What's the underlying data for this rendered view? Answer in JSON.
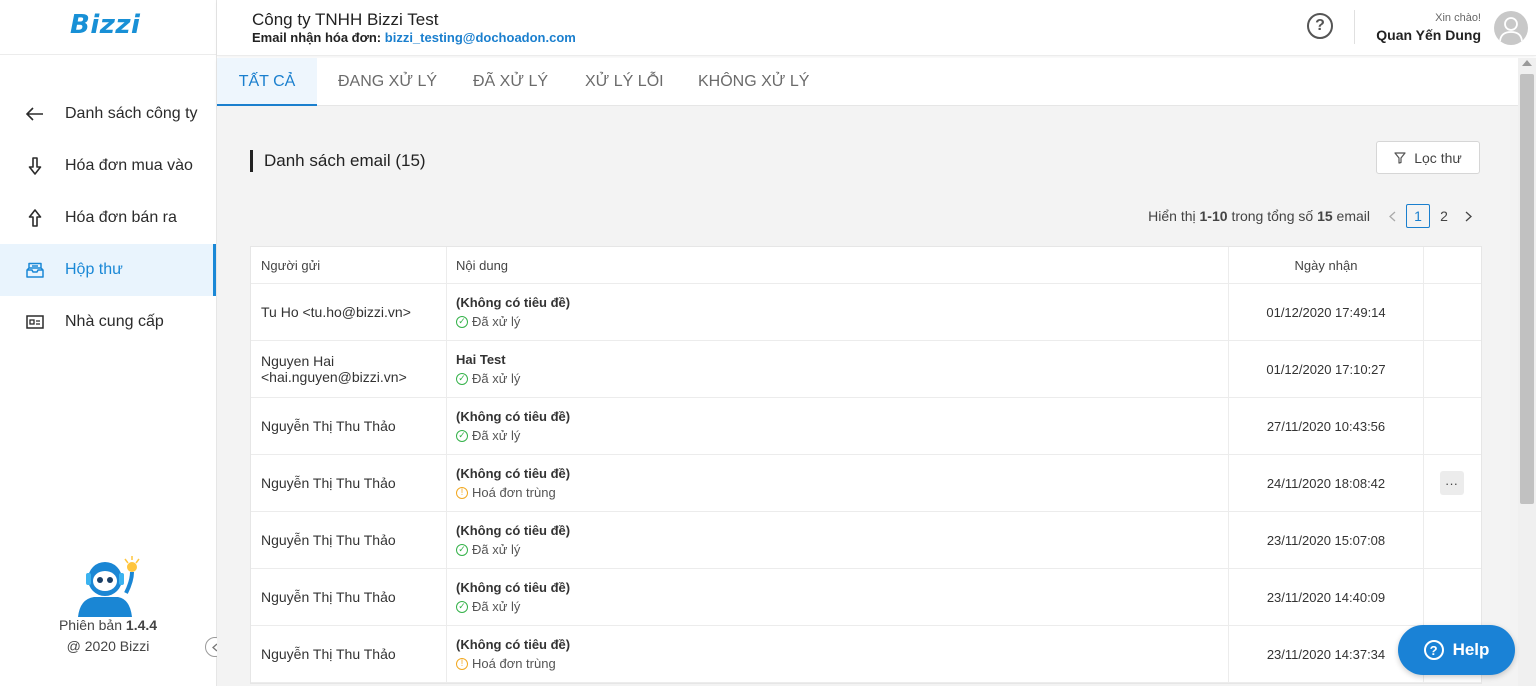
{
  "brand": {
    "logo": "Bizzi"
  },
  "header": {
    "company": "Công ty TNHH Bizzi Test",
    "email_label": "Email nhận hóa đơn:",
    "email": "bizzi_testing@dochoadon.com",
    "help_glyph": "?",
    "greeting": "Xin chào!",
    "user_name": "Quan Yến Dung"
  },
  "sidebar": {
    "items": [
      {
        "label": "Danh sách công ty",
        "icon": "arrow-left-icon"
      },
      {
        "label": "Hóa đơn mua vào",
        "icon": "arrow-down-icon"
      },
      {
        "label": "Hóa đơn bán ra",
        "icon": "arrow-up-icon"
      },
      {
        "label": "Hộp thư",
        "icon": "inbox-icon",
        "active": true
      },
      {
        "label": "Nhà cung cấp",
        "icon": "id-card-icon"
      }
    ],
    "version_label": "Phiên bản",
    "version": "1.4.4",
    "copyright": "@ 2020 Bizzi"
  },
  "tabs": [
    {
      "label": "TẤT CẢ",
      "active": true
    },
    {
      "label": "ĐANG XỬ LÝ"
    },
    {
      "label": "ĐÃ XỬ LÝ"
    },
    {
      "label": "XỬ LÝ LỖI"
    },
    {
      "label": "KHÔNG XỬ LÝ"
    }
  ],
  "main": {
    "section_title": "Danh sách email (15)",
    "filter_label": "Lọc thư",
    "pager": {
      "prefix": "Hiển thị",
      "range": "1-10",
      "middle": "trong tổng số",
      "total": "15",
      "suffix": "email",
      "pages": [
        "1",
        "2"
      ],
      "current": "1"
    },
    "table": {
      "headers": [
        "Người gửi",
        "Nội dung",
        "Ngày nhận"
      ],
      "rows": [
        {
          "sender": "Tu Ho <tu.ho@bizzi.vn>",
          "subject": "(Không có tiêu đề)",
          "status": "Đã xử lý",
          "status_type": "ok",
          "date": "01/12/2020 17:49:14"
        },
        {
          "sender": "Nguyen Hai <hai.nguyen@bizzi.vn>",
          "subject": "Hai Test",
          "status": "Đã xử lý",
          "status_type": "ok",
          "date": "01/12/2020 17:10:27"
        },
        {
          "sender": "Nguyễn Thị Thu Thảo",
          "subject": "(Không có tiêu đề)",
          "status": "Đã xử lý",
          "status_type": "ok",
          "date": "27/11/2020 10:43:56"
        },
        {
          "sender": "Nguyễn Thị Thu Thảo",
          "subject": "(Không có tiêu đề)",
          "status": "Hoá đơn trùng",
          "status_type": "warn",
          "date": "24/11/2020 18:08:42",
          "more": "···"
        },
        {
          "sender": "Nguyễn Thị Thu Thảo",
          "subject": "(Không có tiêu đề)",
          "status": "Đã xử lý",
          "status_type": "ok",
          "date": "23/11/2020 15:07:08"
        },
        {
          "sender": "Nguyễn Thị Thu Thảo",
          "subject": "(Không có tiêu đề)",
          "status": "Đã xử lý",
          "status_type": "ok",
          "date": "23/11/2020 14:40:09"
        },
        {
          "sender": "Nguyễn Thị Thu Thảo",
          "subject": "(Không có tiêu đề)",
          "status": "Hoá đơn trùng",
          "status_type": "warn",
          "date": "23/11/2020 14:37:34"
        }
      ]
    }
  },
  "help_fab": {
    "label": "Help",
    "glyph": "?"
  },
  "colors": {
    "accent": "#1a7fce",
    "ok": "#35b24a",
    "warn": "#f2a922"
  }
}
